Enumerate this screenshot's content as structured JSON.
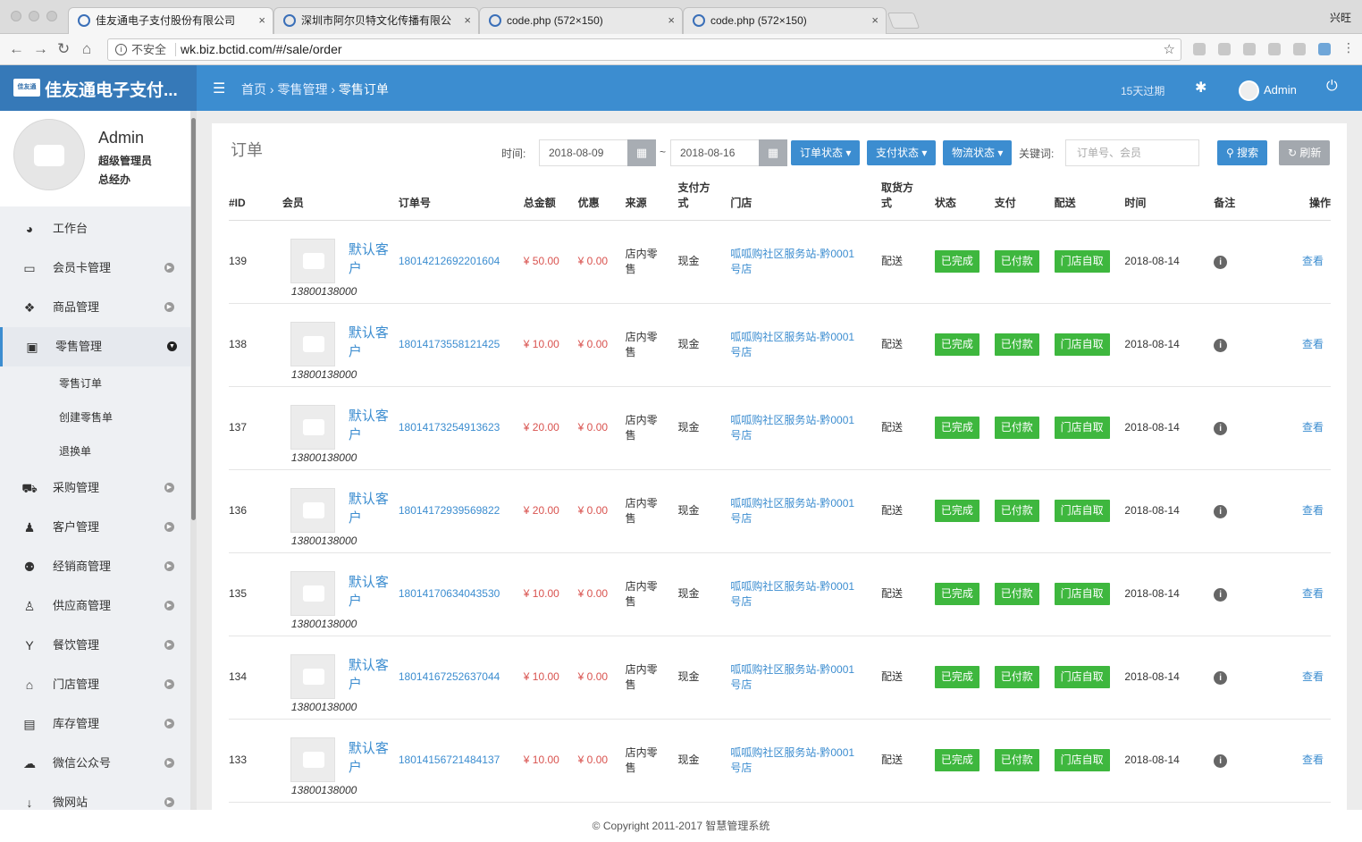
{
  "browser": {
    "tabs": [
      {
        "title": "佳友通电子支付股份有限公司",
        "active": true
      },
      {
        "title": "深圳市阿尔贝特文化传播有限公",
        "active": false
      },
      {
        "title": "code.php (572×150)",
        "active": false
      },
      {
        "title": "code.php (572×150)",
        "active": false
      }
    ],
    "window_user": "兴旺",
    "insecure_label": "不安全",
    "url": "wk.biz.bctid.com/#/sale/order"
  },
  "header": {
    "brand": "佳友通电子支付...",
    "breadcrumb": {
      "home": "首页",
      "section": "零售管理",
      "current": "零售订单"
    },
    "expire": "15天过期",
    "admin": "Admin"
  },
  "profile": {
    "name": "Admin",
    "role": "超级管理员",
    "dept": "总经办"
  },
  "menu": [
    {
      "label": "工作台",
      "icon": "dashboard-icon",
      "glyph": "◕",
      "arrow": false,
      "active": false
    },
    {
      "label": "会员卡管理",
      "icon": "card-icon",
      "glyph": "▭",
      "arrow": true,
      "active": false
    },
    {
      "label": "商品管理",
      "icon": "cubes-icon",
      "glyph": "❖",
      "arrow": true,
      "active": false
    },
    {
      "label": "零售管理",
      "icon": "money-icon",
      "glyph": "▣",
      "arrow": true,
      "active": true
    },
    {
      "label": "采购管理",
      "icon": "cart-icon",
      "glyph": "⛟",
      "arrow": true,
      "active": false
    },
    {
      "label": "客户管理",
      "icon": "user-icon",
      "glyph": "♟",
      "arrow": true,
      "active": false
    },
    {
      "label": "经销商管理",
      "icon": "users-icon",
      "glyph": "⚉",
      "arrow": true,
      "active": false
    },
    {
      "label": "供应商管理",
      "icon": "person-icon",
      "glyph": "♙",
      "arrow": true,
      "active": false
    },
    {
      "label": "餐饮管理",
      "icon": "glass-icon",
      "glyph": "Y",
      "arrow": true,
      "active": false
    },
    {
      "label": "门店管理",
      "icon": "home-icon",
      "glyph": "⌂",
      "arrow": true,
      "active": false
    },
    {
      "label": "库存管理",
      "icon": "archive-icon",
      "glyph": "▤",
      "arrow": true,
      "active": false
    },
    {
      "label": "微信公众号",
      "icon": "wechat-icon",
      "glyph": "☁",
      "arrow": true,
      "active": false
    },
    {
      "label": "微网站",
      "icon": "site-icon",
      "glyph": "↓",
      "arrow": true,
      "active": false
    }
  ],
  "submenu": [
    "零售订单",
    "创建零售单",
    "退换单"
  ],
  "page": {
    "title": "订单",
    "time_label": "时间:",
    "date_from": "2018-08-09",
    "date_sep": "~",
    "date_to": "2018-08-16",
    "order_status": "订单状态",
    "pay_status": "支付状态",
    "ship_status": "物流状态",
    "keyword_label": "关键词:",
    "keyword_placeholder": "订单号、会员",
    "search": "搜索",
    "refresh": "刷新"
  },
  "columns": [
    "#ID",
    "会员",
    "订单号",
    "总金额",
    "优惠",
    "来源",
    "支付方式",
    "门店",
    "取货方式",
    "状态",
    "支付",
    "配送",
    "时间",
    "备注",
    "操作"
  ],
  "orders": [
    {
      "id": "139",
      "member": "默认客户",
      "phone": "13800138000",
      "order_no": "18014212692201604",
      "total": "¥ 50.00",
      "discount": "¥ 0.00",
      "source": "店内零售",
      "pay_method": "现金",
      "store": "呱呱购社区服务站-黔0001号店",
      "pickup": "配送",
      "status": "已完成",
      "pay": "已付款",
      "delivery": "门店自取",
      "time": "2018-08-14",
      "action": "查看"
    },
    {
      "id": "138",
      "member": "默认客户",
      "phone": "13800138000",
      "order_no": "18014173558121425",
      "total": "¥ 10.00",
      "discount": "¥ 0.00",
      "source": "店内零售",
      "pay_method": "现金",
      "store": "呱呱购社区服务站-黔0001号店",
      "pickup": "配送",
      "status": "已完成",
      "pay": "已付款",
      "delivery": "门店自取",
      "time": "2018-08-14",
      "action": "查看"
    },
    {
      "id": "137",
      "member": "默认客户",
      "phone": "13800138000",
      "order_no": "18014173254913623",
      "total": "¥ 20.00",
      "discount": "¥ 0.00",
      "source": "店内零售",
      "pay_method": "现金",
      "store": "呱呱购社区服务站-黔0001号店",
      "pickup": "配送",
      "status": "已完成",
      "pay": "已付款",
      "delivery": "门店自取",
      "time": "2018-08-14",
      "action": "查看"
    },
    {
      "id": "136",
      "member": "默认客户",
      "phone": "13800138000",
      "order_no": "18014172939569822",
      "total": "¥ 20.00",
      "discount": "¥ 0.00",
      "source": "店内零售",
      "pay_method": "现金",
      "store": "呱呱购社区服务站-黔0001号店",
      "pickup": "配送",
      "status": "已完成",
      "pay": "已付款",
      "delivery": "门店自取",
      "time": "2018-08-14",
      "action": "查看"
    },
    {
      "id": "135",
      "member": "默认客户",
      "phone": "13800138000",
      "order_no": "18014170634043530",
      "total": "¥ 10.00",
      "discount": "¥ 0.00",
      "source": "店内零售",
      "pay_method": "现金",
      "store": "呱呱购社区服务站-黔0001号店",
      "pickup": "配送",
      "status": "已完成",
      "pay": "已付款",
      "delivery": "门店自取",
      "time": "2018-08-14",
      "action": "查看"
    },
    {
      "id": "134",
      "member": "默认客户",
      "phone": "13800138000",
      "order_no": "18014167252637044",
      "total": "¥ 10.00",
      "discount": "¥ 0.00",
      "source": "店内零售",
      "pay_method": "现金",
      "store": "呱呱购社区服务站-黔0001号店",
      "pickup": "配送",
      "status": "已完成",
      "pay": "已付款",
      "delivery": "门店自取",
      "time": "2018-08-14",
      "action": "查看"
    },
    {
      "id": "133",
      "member": "默认客户",
      "phone": "13800138000",
      "order_no": "18014156721484137",
      "total": "¥ 10.00",
      "discount": "¥ 0.00",
      "source": "店内零售",
      "pay_method": "现金",
      "store": "呱呱购社区服务站-黔0001号店",
      "pickup": "配送",
      "status": "已完成",
      "pay": "已付款",
      "delivery": "门店自取",
      "time": "2018-08-14",
      "action": "查看"
    }
  ],
  "footer": "© Copyright 2011-2017 智慧管理系统",
  "colors": {
    "primary": "#3c8dd0",
    "brand_bg": "#3679b8",
    "success": "#3eb73e",
    "danger": "#d9534f"
  }
}
